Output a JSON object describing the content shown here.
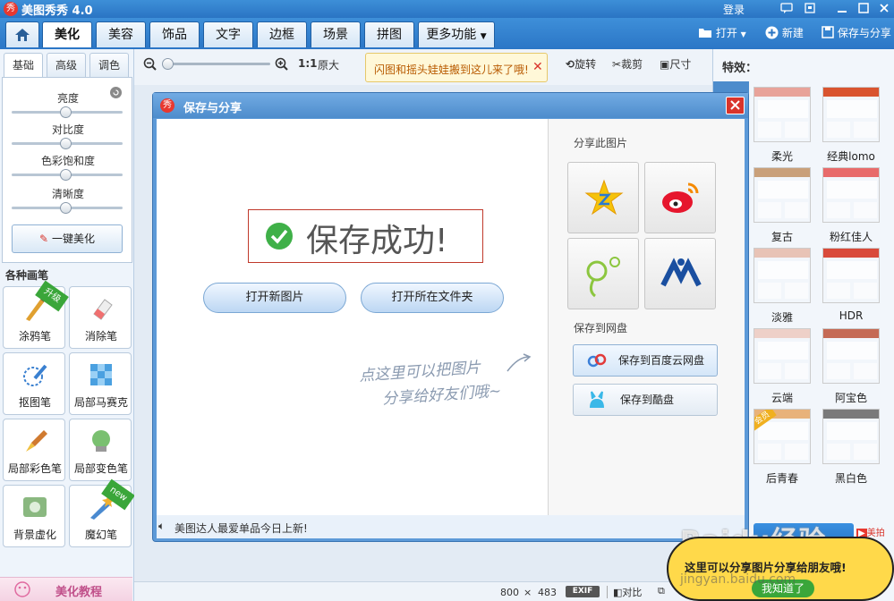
{
  "window": {
    "title": "美图秀秀 4.0",
    "logo_text": "秀",
    "login_label": "登录",
    "buttons": [
      "chat-icon",
      "window-icon",
      "minimize-icon",
      "restore-icon",
      "close-icon"
    ]
  },
  "tabs": {
    "home_icon": "home-icon",
    "items": [
      "美化",
      "美容",
      "饰品",
      "文字",
      "边框",
      "场景",
      "拼图",
      "更多功能"
    ],
    "active": "美化"
  },
  "top_actions": {
    "open_label": "打开",
    "new_label": "新建",
    "save_share_label": "保存与分享"
  },
  "adjust_panel": {
    "subtabs": [
      "基础",
      "高级",
      "调色"
    ],
    "sliders": [
      {
        "label": "亮度",
        "value": 0.5
      },
      {
        "label": "对比度",
        "value": 0.5
      },
      {
        "label": "色彩饱和度",
        "value": 0.5
      },
      {
        "label": "清晰度",
        "value": 0.5
      }
    ],
    "one_click_label": "一键美化",
    "brushes_title": "各种画笔",
    "brushes": [
      {
        "label": "涂鸦笔",
        "badge": "升级"
      },
      {
        "label": "消除笔",
        "badge": ""
      },
      {
        "label": "抠图笔",
        "badge": ""
      },
      {
        "label": "局部马赛克",
        "badge": ""
      },
      {
        "label": "局部彩色笔",
        "badge": ""
      },
      {
        "label": "局部变色笔",
        "badge": ""
      },
      {
        "label": "背景虚化",
        "badge": ""
      },
      {
        "label": "魔幻笔",
        "badge": "new"
      }
    ],
    "tutorial_label": "美化教程"
  },
  "zoom_toolbar": {
    "ratio_label": "1:1",
    "original_label": "原大",
    "zoom_value": 0.02,
    "tip_text": "闪图和摇头娃娃搬到这儿来了哦!",
    "rotate_label": "旋转",
    "crop_label": "裁剪",
    "size_label": "尺寸"
  },
  "effects_panel": {
    "title": "特效：",
    "items": [
      {
        "label": "柔光",
        "color": "#e8a39a"
      },
      {
        "label": "经典lomo",
        "color": "#d9542f"
      },
      {
        "label": "复古",
        "color": "#c9a07a"
      },
      {
        "label": "粉红佳人",
        "color": "#e86a6a"
      },
      {
        "label": "淡雅",
        "color": "#e8c3b6"
      },
      {
        "label": "HDR",
        "color": "#d94a3a"
      },
      {
        "label": "云端",
        "color": "#eed0c8"
      },
      {
        "label": "阿宝色",
        "color": "#c56a55"
      },
      {
        "label": "后青春",
        "color": "#e8b27a",
        "badge": "会员"
      },
      {
        "label": "黑白色",
        "color": "#7a7a7a"
      }
    ]
  },
  "dialog": {
    "title": "保存与分享",
    "success_text": "保存成功!",
    "open_new_label": "打开新图片",
    "open_folder_label": "打开所在文件夹",
    "hint_line1": "点这里可以把图片",
    "hint_line2": "分享给好友们哦~",
    "share_title": "分享此图片",
    "share_targets": [
      "qzone-icon",
      "weibo-icon",
      "pengyou-icon",
      "renren-icon"
    ],
    "cloud_title": "保存到网盘",
    "cloud_targets": [
      {
        "label": "保存到百度云网盘",
        "icon": "baidu-cloud-icon"
      },
      {
        "label": "保存到酷盘",
        "icon": "kupan-icon"
      }
    ],
    "footer_text": "美图达人最爱单品今日上新!"
  },
  "status_bar": {
    "width": "800",
    "times": "×",
    "height": "483",
    "exif_label": "EXIF",
    "compare_label": "对比"
  },
  "promo": {
    "brand": "美拍",
    "bubble_text": "这里可以分享图片分享给朋友哦!",
    "got_it_label": "我知道了",
    "watermark_main": "Baidu经验",
    "watermark_url": "jingyan.baidu.com"
  },
  "colors": {
    "titlebar": "#2a74c3",
    "accent_red": "#d9342b",
    "success_green": "#3fb048",
    "bubble_yellow": "#ffd94a"
  }
}
